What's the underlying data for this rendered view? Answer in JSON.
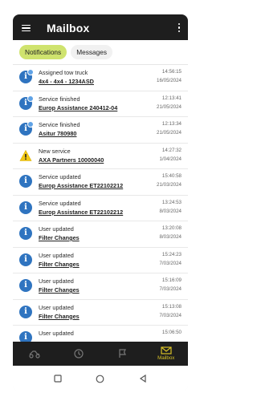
{
  "app": {
    "title": "Mailbox"
  },
  "tabs": [
    {
      "label": "Notifications",
      "active": true
    },
    {
      "label": "Messages",
      "active": false
    }
  ],
  "colors": {
    "header": "#1e1e1e",
    "accent": "#cfe36e",
    "info": "#2f74c0",
    "warning": "#f2c814",
    "nav_active": "#d8c227"
  },
  "notifications": [
    {
      "icon": "info-icon",
      "unread": true,
      "title": "Assigned tow truck",
      "subtitle": "4x4 - 4x4 - 1234ASD",
      "time": "14:56:15",
      "date": "16/05/2024"
    },
    {
      "icon": "info-icon",
      "unread": true,
      "title": "Service finished",
      "subtitle": "Europ Assistance 240412-04",
      "time": "12:13:41",
      "date": "21/05/2024"
    },
    {
      "icon": "info-icon",
      "unread": true,
      "title": "Service finished",
      "subtitle": "Asitur 780980",
      "time": "12:13:34",
      "date": "21/05/2024"
    },
    {
      "icon": "warning-icon",
      "unread": false,
      "title": "New service",
      "subtitle": "AXA Partners 10000040",
      "time": "14:27:32",
      "date": "1/04/2024"
    },
    {
      "icon": "info-icon",
      "unread": false,
      "title": "Service updated",
      "subtitle": "Europ Assistance ET22102212",
      "time": "15:40:58",
      "date": "21/03/2024"
    },
    {
      "icon": "info-icon",
      "unread": false,
      "title": "Service updated",
      "subtitle": "Europ Assistance ET22102212",
      "time": "13:24:53",
      "date": "8/03/2024"
    },
    {
      "icon": "info-icon",
      "unread": false,
      "title": "User updated",
      "subtitle": "Filter Changes",
      "time": "13:20:08",
      "date": "8/03/2024"
    },
    {
      "icon": "info-icon",
      "unread": false,
      "title": "User updated",
      "subtitle": "Filter Changes",
      "time": "15:24:23",
      "date": "7/03/2024"
    },
    {
      "icon": "info-icon",
      "unread": false,
      "title": "User updated",
      "subtitle": "Filter Changes",
      "time": "15:16:09",
      "date": "7/03/2024"
    },
    {
      "icon": "info-icon",
      "unread": false,
      "title": "User updated",
      "subtitle": "Filter Changes",
      "time": "15:13:08",
      "date": "7/03/2024"
    },
    {
      "icon": "info-icon",
      "unread": false,
      "title": "User updated",
      "subtitle": "",
      "time": "15:06:50",
      "date": ""
    }
  ],
  "bottom_nav": [
    {
      "icon": "tow-truck-icon",
      "label": "",
      "active": false
    },
    {
      "icon": "clock-icon",
      "label": "",
      "active": false
    },
    {
      "icon": "flag-icon",
      "label": "",
      "active": false
    },
    {
      "icon": "mail-icon",
      "label": "Mailbox",
      "active": true
    }
  ],
  "system_nav": [
    {
      "icon": "recents-square-icon"
    },
    {
      "icon": "home-circle-icon"
    },
    {
      "icon": "back-triangle-icon"
    }
  ]
}
